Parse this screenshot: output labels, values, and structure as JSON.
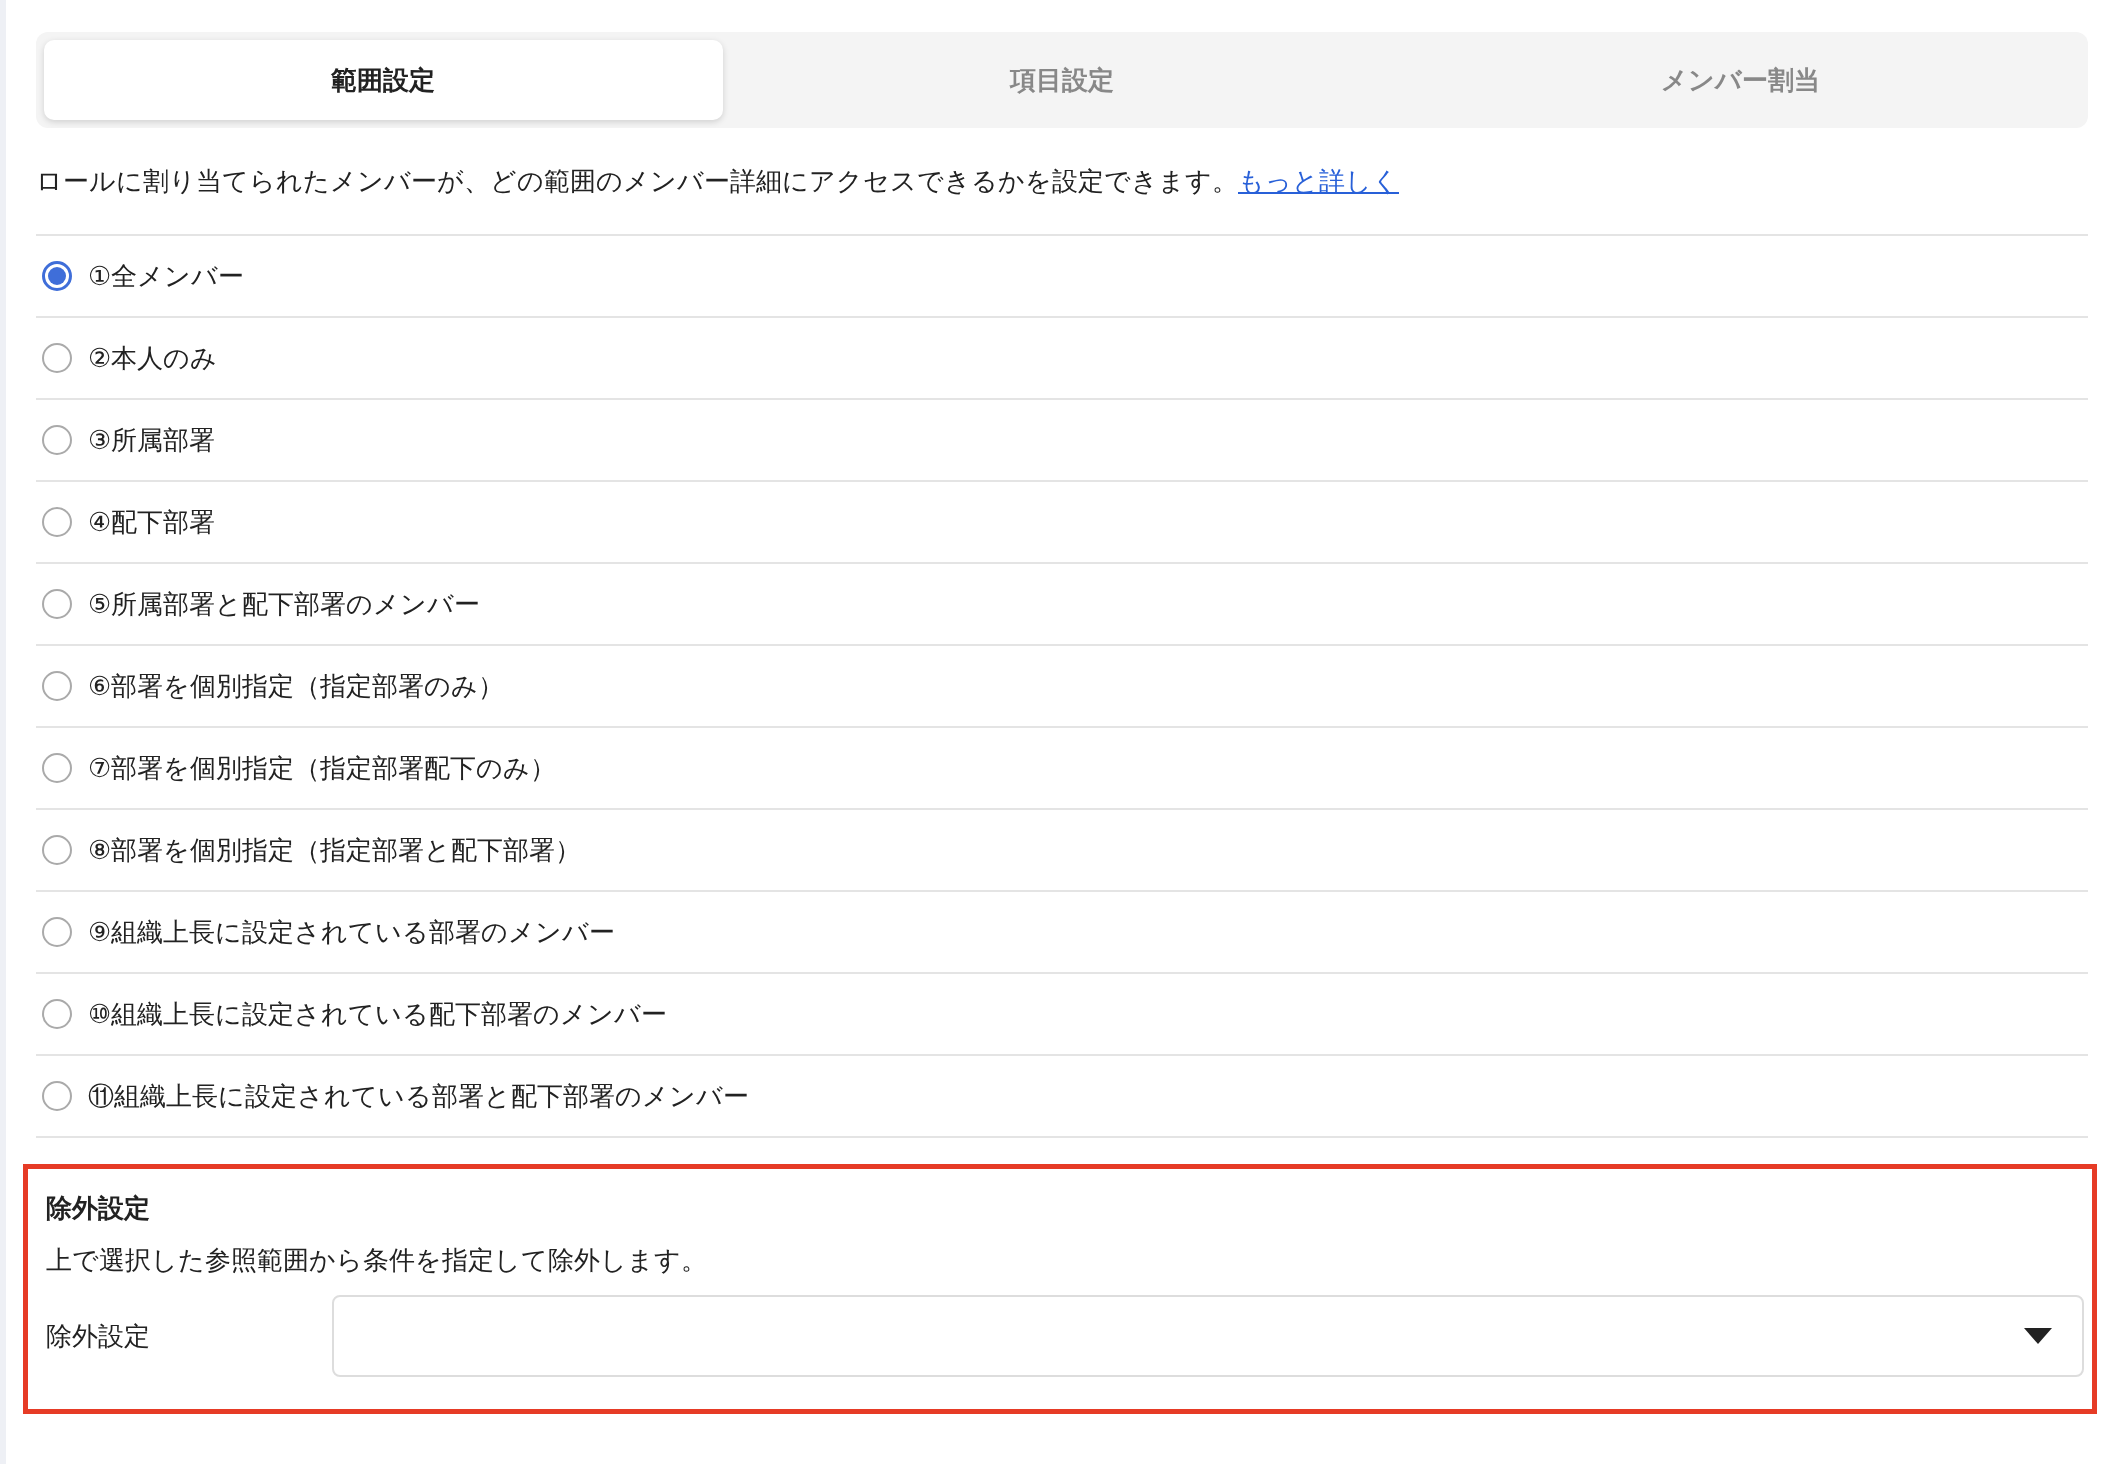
{
  "tabs": [
    {
      "label": "範囲設定",
      "selected": true
    },
    {
      "label": "項目設定",
      "selected": false
    },
    {
      "label": "メンバー割当",
      "selected": false
    }
  ],
  "description": {
    "text": "ロールに割り当てられたメンバーが、どの範囲のメンバー詳細にアクセスできるかを設定できます。",
    "link": "もっと詳しく"
  },
  "scope_options": [
    {
      "label": "①全メンバー",
      "selected": true
    },
    {
      "label": "②本人のみ",
      "selected": false
    },
    {
      "label": "③所属部署",
      "selected": false
    },
    {
      "label": "④配下部署",
      "selected": false
    },
    {
      "label": "⑤所属部署と配下部署のメンバー",
      "selected": false
    },
    {
      "label": "⑥部署を個別指定（指定部署のみ）",
      "selected": false
    },
    {
      "label": "⑦部署を個別指定（指定部署配下のみ）",
      "selected": false
    },
    {
      "label": "⑧部署を個別指定（指定部署と配下部署）",
      "selected": false
    },
    {
      "label": "⑨組織上長に設定されている部署のメンバー",
      "selected": false
    },
    {
      "label": "⑩組織上長に設定されている配下部署のメンバー",
      "selected": false
    },
    {
      "label": "⑪組織上長に設定されている部署と配下部署のメンバー",
      "selected": false
    }
  ],
  "exclusion": {
    "title": "除外設定",
    "description": "上で選択した参照範囲から条件を指定して除外します。",
    "field_label": "除外設定"
  }
}
